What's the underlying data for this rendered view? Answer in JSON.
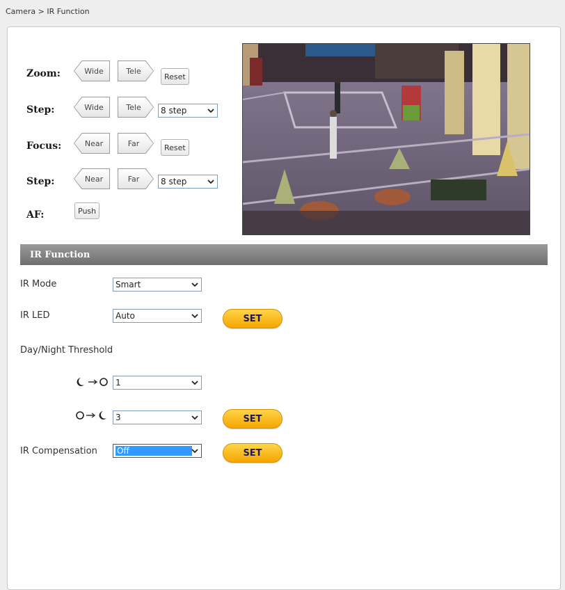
{
  "breadcrumb": "Camera > IR Function",
  "controls": {
    "zoom": {
      "label": "Zoom:",
      "wide": "Wide",
      "tele": "Tele",
      "reset": "Reset"
    },
    "zoom_step": {
      "label": "Step:",
      "wide": "Wide",
      "tele": "Tele",
      "value": "8 step"
    },
    "focus": {
      "label": "Focus:",
      "near": "Near",
      "far": "Far",
      "reset": "Reset"
    },
    "focus_step": {
      "label": "Step:",
      "near": "Near",
      "far": "Far",
      "value": "8 step"
    },
    "af": {
      "label": "AF:",
      "push": "Push"
    }
  },
  "ir": {
    "section_title": "IR Function",
    "mode": {
      "label": "IR Mode",
      "value": "Smart"
    },
    "led": {
      "label": "IR LED",
      "value": "Auto",
      "set": "SET"
    },
    "threshold": {
      "label": "Day/Night Threshold",
      "night_to_day": "1",
      "day_to_night": "3",
      "set": "SET"
    },
    "compensation": {
      "label": "IR Compensation",
      "value": "Off",
      "set": "SET"
    }
  },
  "colors": {
    "set_button": "#f5a600",
    "section_bar": "#7a7a7a",
    "highlight": "#3399ff"
  }
}
